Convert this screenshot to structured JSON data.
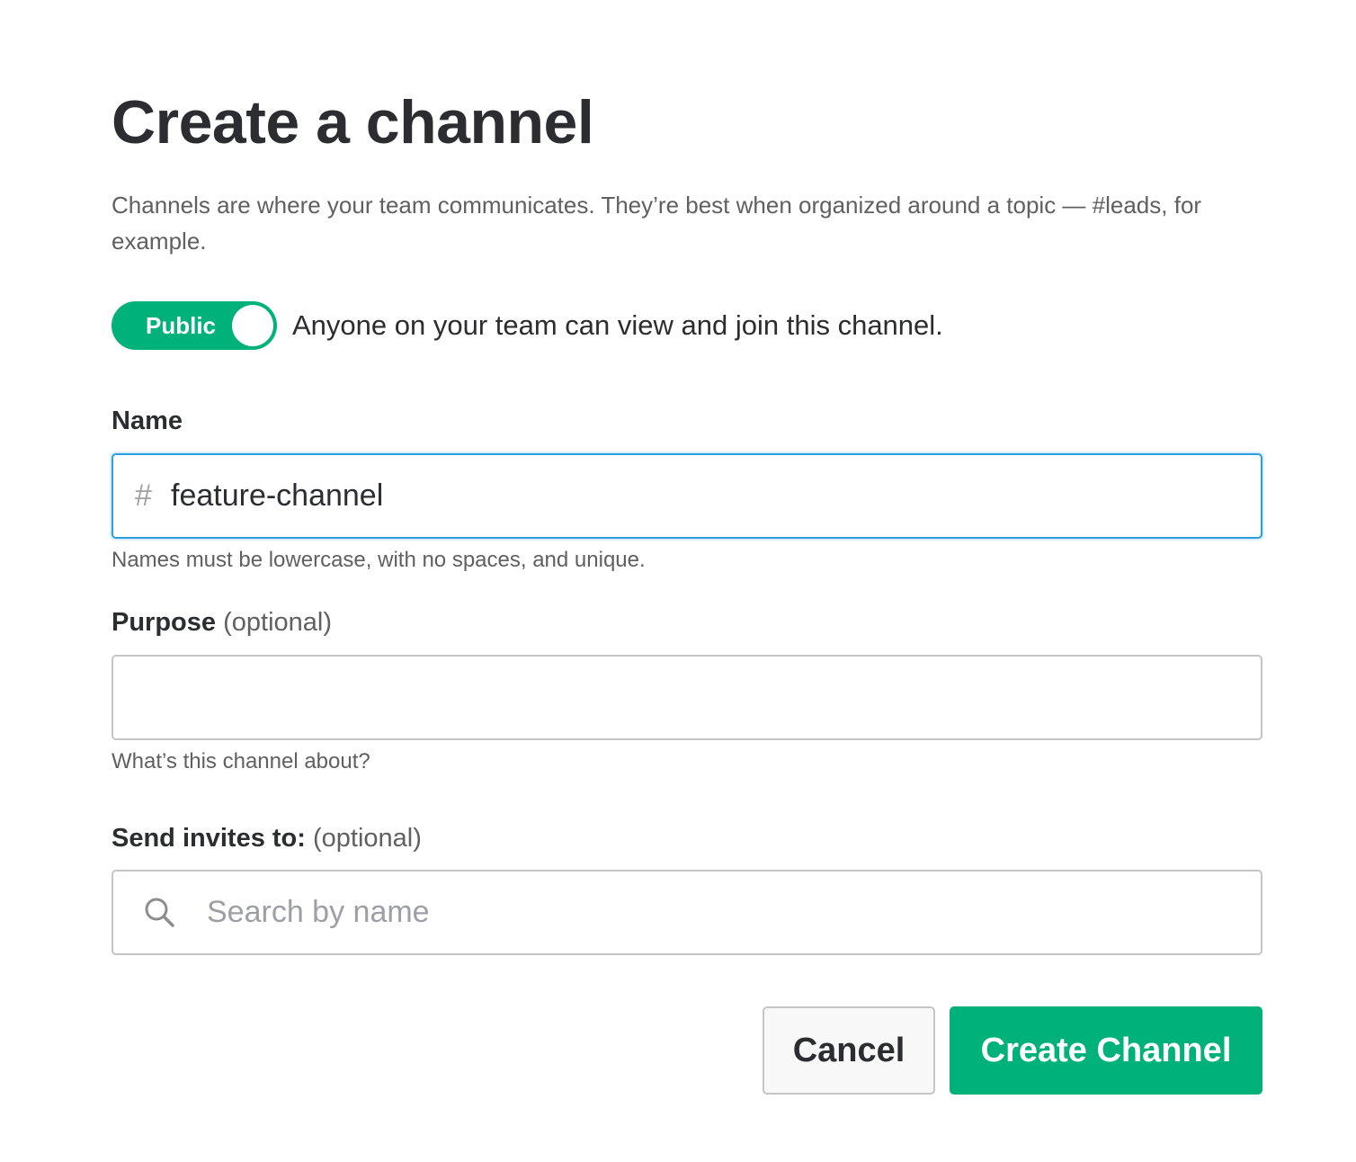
{
  "dialog": {
    "title": "Create a channel",
    "description": "Channels are where your team communicates. They’re best when organized around a topic — #leads, for example."
  },
  "visibility_toggle": {
    "label": "Public",
    "state": "on",
    "description": "Anyone on your team can view and join this channel.",
    "color": "#00b27a"
  },
  "name_field": {
    "label": "Name",
    "prefix": "#",
    "value": "feature-channel",
    "hint": "Names must be lowercase, with no spaces, and unique."
  },
  "purpose_field": {
    "label": "Purpose",
    "optional": "(optional)",
    "value": "",
    "hint": "What’s this channel about?"
  },
  "invites_field": {
    "label": "Send invites to:",
    "optional": "(optional)",
    "placeholder": "Search by name",
    "icon": "search-icon"
  },
  "actions": {
    "cancel_label": "Cancel",
    "create_label": "Create Channel",
    "create_color": "#00b27a"
  }
}
